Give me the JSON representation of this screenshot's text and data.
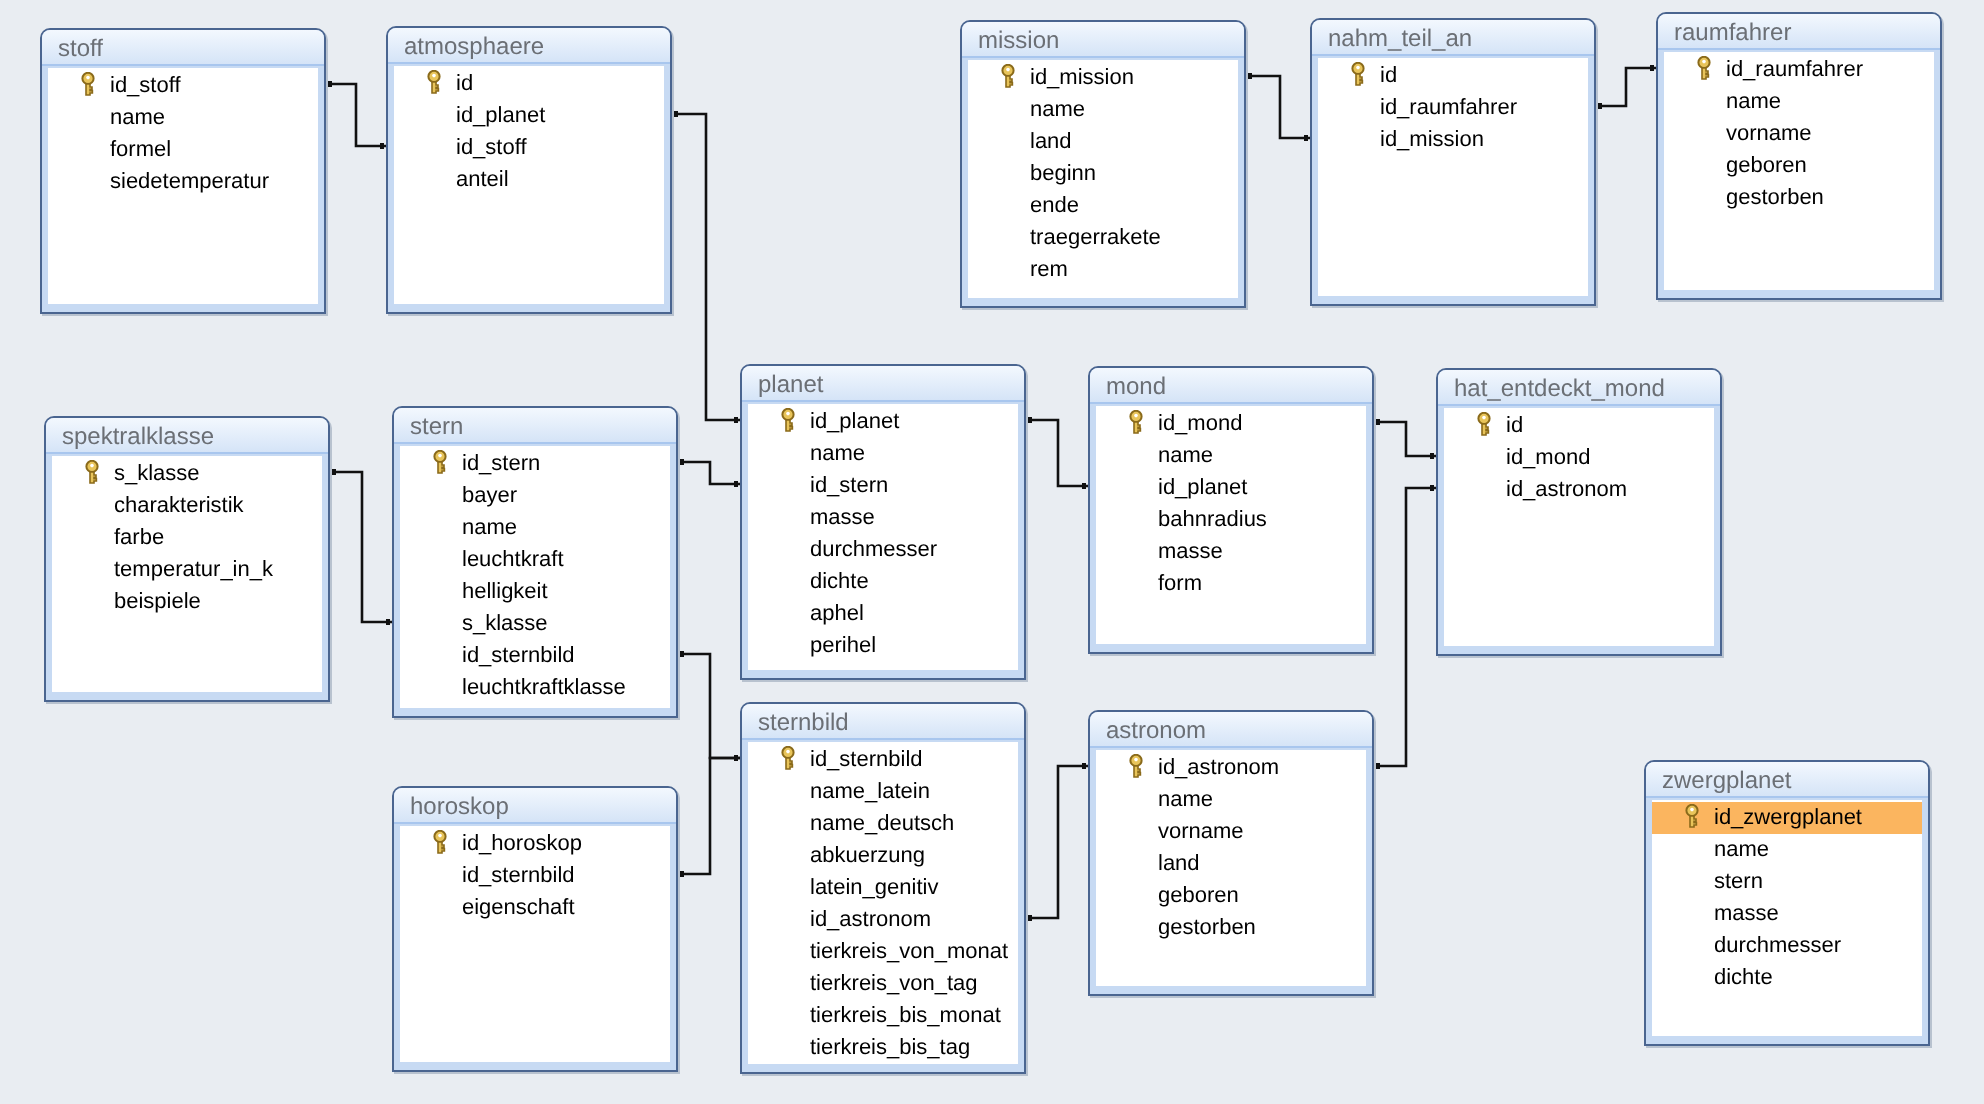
{
  "tables": [
    {
      "title": "stoff",
      "fields": [
        {
          "name": "id_stoff",
          "key": true,
          "selected": false
        },
        {
          "name": "name",
          "key": false,
          "selected": false
        },
        {
          "name": "formel",
          "key": false,
          "selected": false
        },
        {
          "name": "siedetemperatur",
          "key": false,
          "selected": false
        }
      ]
    },
    {
      "title": "atmosphaere",
      "fields": [
        {
          "name": "id",
          "key": true,
          "selected": false
        },
        {
          "name": "id_planet",
          "key": false,
          "selected": false
        },
        {
          "name": "id_stoff",
          "key": false,
          "selected": false
        },
        {
          "name": "anteil",
          "key": false,
          "selected": false
        }
      ]
    },
    {
      "title": "mission",
      "fields": [
        {
          "name": "id_mission",
          "key": true,
          "selected": false
        },
        {
          "name": "name",
          "key": false,
          "selected": false
        },
        {
          "name": "land",
          "key": false,
          "selected": false
        },
        {
          "name": "beginn",
          "key": false,
          "selected": false
        },
        {
          "name": "ende",
          "key": false,
          "selected": false
        },
        {
          "name": "traegerrakete",
          "key": false,
          "selected": false
        },
        {
          "name": "rem",
          "key": false,
          "selected": false
        }
      ]
    },
    {
      "title": "nahm_teil_an",
      "fields": [
        {
          "name": "id",
          "key": true,
          "selected": false
        },
        {
          "name": "id_raumfahrer",
          "key": false,
          "selected": false
        },
        {
          "name": "id_mission",
          "key": false,
          "selected": false
        }
      ]
    },
    {
      "title": "raumfahrer",
      "fields": [
        {
          "name": "id_raumfahrer",
          "key": true,
          "selected": false
        },
        {
          "name": "name",
          "key": false,
          "selected": false
        },
        {
          "name": "vorname",
          "key": false,
          "selected": false
        },
        {
          "name": "geboren",
          "key": false,
          "selected": false
        },
        {
          "name": "gestorben",
          "key": false,
          "selected": false
        }
      ]
    },
    {
      "title": "spektralklasse",
      "fields": [
        {
          "name": "s_klasse",
          "key": true,
          "selected": false
        },
        {
          "name": "charakteristik",
          "key": false,
          "selected": false
        },
        {
          "name": "farbe",
          "key": false,
          "selected": false
        },
        {
          "name": "temperatur_in_k",
          "key": false,
          "selected": false
        },
        {
          "name": "beispiele",
          "key": false,
          "selected": false
        }
      ]
    },
    {
      "title": "stern",
      "fields": [
        {
          "name": "id_stern",
          "key": true,
          "selected": false
        },
        {
          "name": "bayer",
          "key": false,
          "selected": false
        },
        {
          "name": "name",
          "key": false,
          "selected": false
        },
        {
          "name": "leuchtkraft",
          "key": false,
          "selected": false
        },
        {
          "name": "helligkeit",
          "key": false,
          "selected": false
        },
        {
          "name": "s_klasse",
          "key": false,
          "selected": false
        },
        {
          "name": "id_sternbild",
          "key": false,
          "selected": false
        },
        {
          "name": "leuchtkraftklasse",
          "key": false,
          "selected": false
        }
      ]
    },
    {
      "title": "planet",
      "fields": [
        {
          "name": "id_planet",
          "key": true,
          "selected": false
        },
        {
          "name": "name",
          "key": false,
          "selected": false
        },
        {
          "name": "id_stern",
          "key": false,
          "selected": false
        },
        {
          "name": "masse",
          "key": false,
          "selected": false
        },
        {
          "name": "durchmesser",
          "key": false,
          "selected": false
        },
        {
          "name": "dichte",
          "key": false,
          "selected": false
        },
        {
          "name": "aphel",
          "key": false,
          "selected": false
        },
        {
          "name": "perihel",
          "key": false,
          "selected": false
        }
      ]
    },
    {
      "title": "mond",
      "fields": [
        {
          "name": "id_mond",
          "key": true,
          "selected": false
        },
        {
          "name": "name",
          "key": false,
          "selected": false
        },
        {
          "name": "id_planet",
          "key": false,
          "selected": false
        },
        {
          "name": "bahnradius",
          "key": false,
          "selected": false
        },
        {
          "name": "masse",
          "key": false,
          "selected": false
        },
        {
          "name": "form",
          "key": false,
          "selected": false
        }
      ]
    },
    {
      "title": "hat_entdeckt_mond",
      "fields": [
        {
          "name": "id",
          "key": true,
          "selected": false
        },
        {
          "name": "id_mond",
          "key": false,
          "selected": false
        },
        {
          "name": "id_astronom",
          "key": false,
          "selected": false
        }
      ]
    },
    {
      "title": "horoskop",
      "fields": [
        {
          "name": "id_horoskop",
          "key": true,
          "selected": false
        },
        {
          "name": "id_sternbild",
          "key": false,
          "selected": false
        },
        {
          "name": "eigenschaft",
          "key": false,
          "selected": false
        }
      ]
    },
    {
      "title": "sternbild",
      "fields": [
        {
          "name": "id_sternbild",
          "key": true,
          "selected": false
        },
        {
          "name": "name_latein",
          "key": false,
          "selected": false
        },
        {
          "name": "name_deutsch",
          "key": false,
          "selected": false
        },
        {
          "name": "abkuerzung",
          "key": false,
          "selected": false
        },
        {
          "name": "latein_genitiv",
          "key": false,
          "selected": false
        },
        {
          "name": "id_astronom",
          "key": false,
          "selected": false
        },
        {
          "name": "tierkreis_von_monat",
          "key": false,
          "selected": false
        },
        {
          "name": "tierkreis_von_tag",
          "key": false,
          "selected": false
        },
        {
          "name": "tierkreis_bis_monat",
          "key": false,
          "selected": false
        },
        {
          "name": "tierkreis_bis_tag",
          "key": false,
          "selected": false
        }
      ]
    },
    {
      "title": "astronom",
      "fields": [
        {
          "name": "id_astronom",
          "key": true,
          "selected": false
        },
        {
          "name": "name",
          "key": false,
          "selected": false
        },
        {
          "name": "vorname",
          "key": false,
          "selected": false
        },
        {
          "name": "land",
          "key": false,
          "selected": false
        },
        {
          "name": "geboren",
          "key": false,
          "selected": false
        },
        {
          "name": "gestorben",
          "key": false,
          "selected": false
        }
      ]
    },
    {
      "title": "zwergplanet",
      "fields": [
        {
          "name": "id_zwergplanet",
          "key": true,
          "selected": true
        },
        {
          "name": "name",
          "key": false,
          "selected": false
        },
        {
          "name": "stern",
          "key": false,
          "selected": false
        },
        {
          "name": "masse",
          "key": false,
          "selected": false
        },
        {
          "name": "durchmesser",
          "key": false,
          "selected": false
        },
        {
          "name": "dichte",
          "key": false,
          "selected": false
        }
      ]
    }
  ]
}
